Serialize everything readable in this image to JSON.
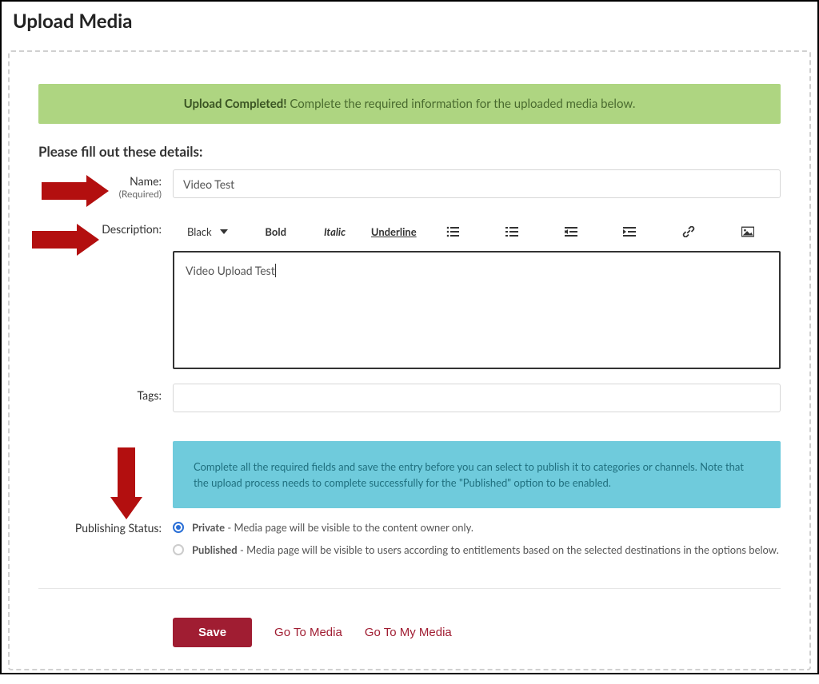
{
  "page_title": "Upload Media",
  "banner": {
    "bold": "Upload Completed!",
    "rest": " Complete the required information for the uploaded media below."
  },
  "subtitle": "Please fill out these details:",
  "fields": {
    "name": {
      "label": "Name:",
      "required_text": "(Required)",
      "value": "Video Test"
    },
    "description": {
      "label": "Description:",
      "value": "Video Upload Test"
    },
    "tags": {
      "label": "Tags:",
      "value": ""
    },
    "publishing_status": {
      "label": "Publishing Status:"
    }
  },
  "toolbar": {
    "color": "Black",
    "bold": "Bold",
    "italic": "Italic",
    "underline": "Underline"
  },
  "info_box": "Complete all the required fields and save the entry before you can select to publish it to categories or channels. Note that the upload process needs to complete successfully for the \"Published\" option to be enabled.",
  "publishing": {
    "private": {
      "bold": "Private",
      "rest": " - Media page will be visible to the content owner only."
    },
    "published": {
      "bold": "Published",
      "rest": " - Media page will be visible to users according to entitlements based on the selected destinations in the options below."
    }
  },
  "buttons": {
    "save": "Save",
    "go_to_media": "Go To Media",
    "go_to_my_media": "Go To My Media"
  },
  "colors": {
    "accent": "#a01d32",
    "banner_bg": "#aed581",
    "info_bg": "#6fcbdc",
    "arrow": "#b30f0f"
  }
}
